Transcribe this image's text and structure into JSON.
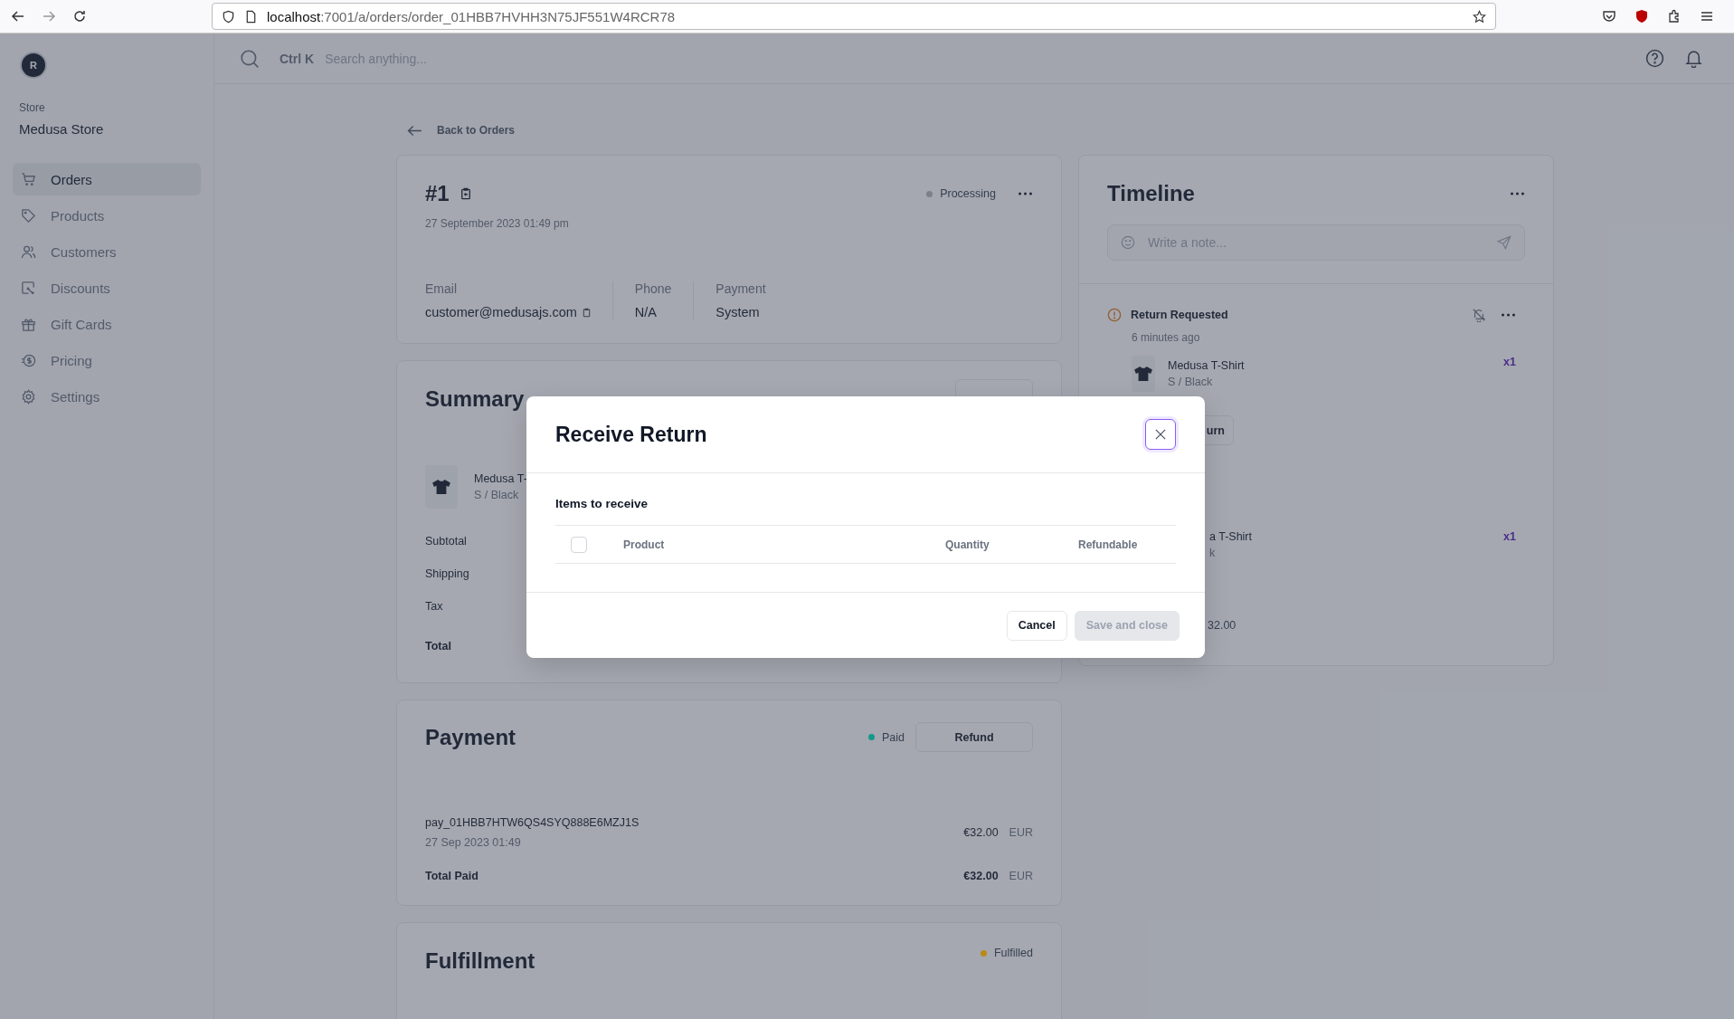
{
  "browser": {
    "url_host": "localhost",
    "url_rest": ":7001/a/orders/order_01HBB7HVHH3N75JF551W4RCR78"
  },
  "sidebar": {
    "avatar": "R",
    "store_label": "Store",
    "store_name": "Medusa Store",
    "items": [
      {
        "label": "Orders",
        "kind": "cart",
        "selected": true
      },
      {
        "label": "Products",
        "kind": "tag",
        "selected": false
      },
      {
        "label": "Customers",
        "kind": "users",
        "selected": false
      },
      {
        "label": "Discounts",
        "kind": "discount",
        "selected": false
      },
      {
        "label": "Gift Cards",
        "kind": "gift",
        "selected": false
      },
      {
        "label": "Pricing",
        "kind": "pricing",
        "selected": false
      },
      {
        "label": "Settings",
        "kind": "gear",
        "selected": false
      }
    ]
  },
  "topbar": {
    "shortcut": "Ctrl K",
    "search_placeholder": "Search anything..."
  },
  "back_link": "Back to Orders",
  "order": {
    "number": "#1",
    "date": "27 September 2023 01:49 pm",
    "status": {
      "label": "Processing",
      "color": "#7b808a"
    },
    "fields": [
      {
        "label": "Email",
        "value": "customer@medusajs.com",
        "copyable": true
      },
      {
        "label": "Phone",
        "value": "N/A",
        "copyable": false
      },
      {
        "label": "Payment",
        "value": "System",
        "copyable": false
      }
    ]
  },
  "summary": {
    "title": "Summary",
    "item": {
      "name": "Medusa T-",
      "variant": "S / Black"
    },
    "rows": [
      {
        "label": "Subtotal",
        "bold": false
      },
      {
        "label": "Shipping",
        "bold": false
      },
      {
        "label": "Tax",
        "bold": false
      },
      {
        "label": "Total",
        "bold": true
      }
    ]
  },
  "payment": {
    "title": "Payment",
    "status": {
      "label": "Paid",
      "color": "#12998a"
    },
    "refund_button": "Refund",
    "id": "pay_01HBB7HTW6QS4SYQ888E6MZJ1S",
    "date": "27 Sep 2023 01:49",
    "amount": "€32.00",
    "currency": "EUR",
    "total_label": "Total Paid",
    "total_amount": "€32.00",
    "total_currency": "EUR"
  },
  "fulfillment": {
    "title": "Fulfillment",
    "status": {
      "label": "Fulfilled",
      "color": "#b98a14"
    }
  },
  "timeline": {
    "title": "Timeline",
    "note_placeholder": "Write a note...",
    "event": {
      "title": "Return Requested",
      "time": "6 minutes ago",
      "item": {
        "name": "Medusa T-Shirt",
        "variant": "S / Black",
        "quantity": "x1"
      },
      "button": "urn"
    },
    "partial": {
      "name": "a T-Shirt",
      "variant": "k",
      "quantity": "x1",
      "amount": "32.00"
    }
  },
  "modal": {
    "title": "Receive Return",
    "section": "Items to receive",
    "select_all_checked": false,
    "columns": [
      "Product",
      "Quantity",
      "Refundable"
    ],
    "buttons": [
      {
        "label": "Cancel",
        "disabled": false
      },
      {
        "label": "Save and close",
        "disabled": true
      }
    ]
  }
}
